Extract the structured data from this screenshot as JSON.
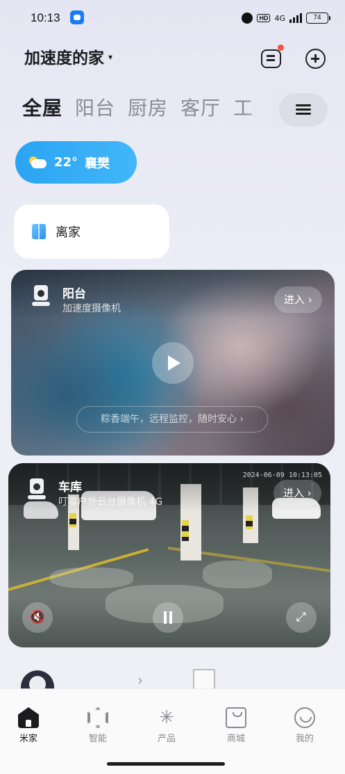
{
  "status_bar": {
    "time": "10:13",
    "hd": "HD",
    "network": "4G",
    "battery": "74"
  },
  "header": {
    "home_name": "加速度的家",
    "caret": "▾"
  },
  "room_tabs": [
    "全屋",
    "阳台",
    "厨房",
    "客厅",
    "工"
  ],
  "weather": {
    "temperature": "22°",
    "city": "襄樊"
  },
  "scene": {
    "label": "离家"
  },
  "cameras": [
    {
      "name": "阳台",
      "model": "加速度摄像机",
      "enter_label": "进入 ›",
      "promo": "粽香端午，远程监控，随时安心 ›"
    },
    {
      "name": "车库",
      "model": "叮零户外云台摄像机 4G",
      "enter_label": "进入 ›",
      "timestamp": "2024-06-09 10:13:05"
    }
  ],
  "bottom_nav": [
    {
      "label": "米家",
      "icon": "home-icon",
      "active": true
    },
    {
      "label": "智能",
      "icon": "smart-icon",
      "active": false
    },
    {
      "label": "产品",
      "icon": "product-icon",
      "active": false
    },
    {
      "label": "商城",
      "icon": "mall-icon",
      "active": false
    },
    {
      "label": "我的",
      "icon": "profile-icon",
      "active": false
    }
  ],
  "colors": {
    "accent_blue": "#2aa4f3",
    "notification_red": "#f2533a",
    "text_primary": "#1c1c1e"
  }
}
